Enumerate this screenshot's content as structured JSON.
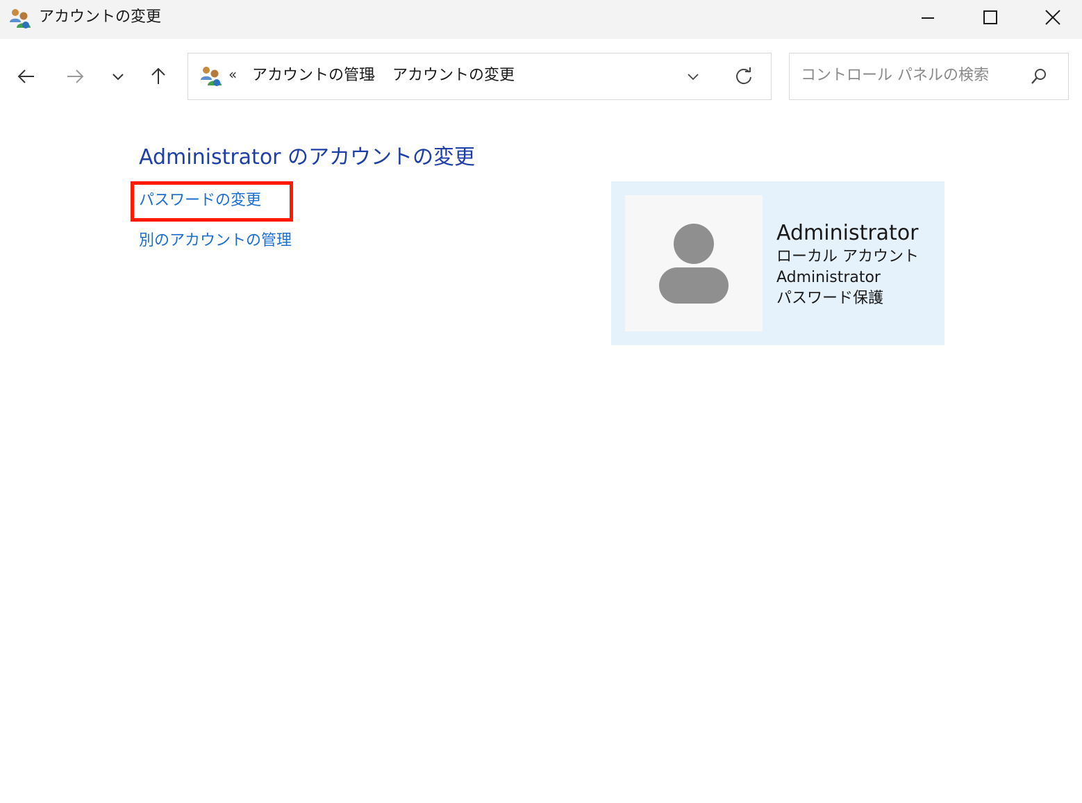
{
  "window": {
    "title": "アカウントの変更"
  },
  "address_bar": {
    "overflow_glyph": "«",
    "crumbs": [
      "アカウントの管理",
      "アカウントの変更"
    ],
    "separator": "›"
  },
  "search": {
    "placeholder": "コントロール パネルの検索"
  },
  "content": {
    "heading": "Administrator のアカウントの変更",
    "links": {
      "change_password": "パスワードの変更",
      "manage_other": "別のアカウントの管理"
    }
  },
  "account": {
    "name": "Administrator",
    "type": "ローカル アカウント",
    "role": "Administrator",
    "protection": "パスワード保護"
  },
  "colors": {
    "heading": "#1e3fa8",
    "link": "#1a6fd1",
    "highlight": "#ff1a00",
    "card_bg": "#e5f1fb"
  }
}
